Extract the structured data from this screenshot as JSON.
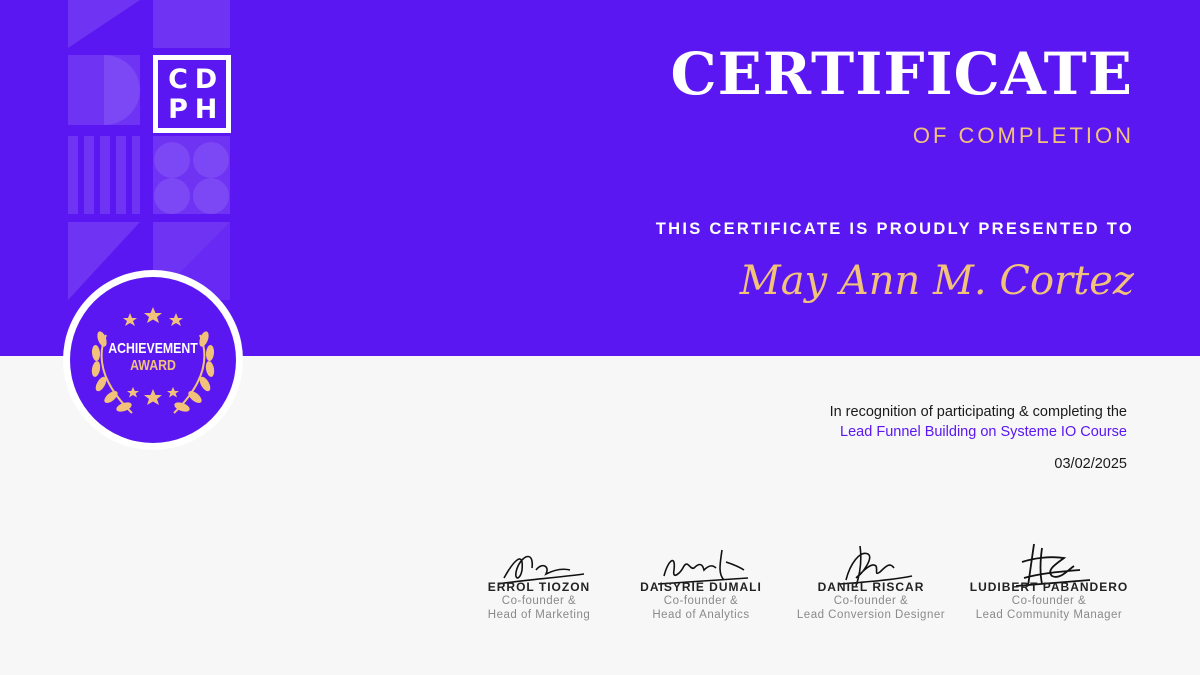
{
  "colors": {
    "primary_purple": "#5b17f2",
    "gold": "#f2c27b",
    "background": "#f7f7f8",
    "white": "#ffffff"
  },
  "logo": {
    "letters": [
      "C",
      "D",
      "P",
      "H"
    ]
  },
  "certificate": {
    "title": "CERTIFICATE",
    "subtitle": "OF COMPLETION",
    "presented_to": "THIS CERTIFICATE IS PROUDLY PRESENTED TO",
    "recipient": "May Ann M. Cortez",
    "recognition": "In recognition of participating & completing the",
    "course": "Lead Funnel Building on Systeme IO Course",
    "date": "03/02/2025"
  },
  "badge": {
    "line1": "ACHIEVEMENT",
    "line2": "AWARD",
    "icons": [
      "star-icon",
      "laurel-wreath-icon"
    ]
  },
  "signers": [
    {
      "name": "ERROL TIOZON",
      "role_line1": "Co-founder &",
      "role_line2": "Head of Marketing"
    },
    {
      "name": "DAISYRIE DUMALI",
      "role_line1": "Co-founder &",
      "role_line2": "Head of Analytics"
    },
    {
      "name": "DANIEL RISCAR",
      "role_line1": "Co-founder &",
      "role_line2": "Lead Conversion Designer"
    },
    {
      "name": "LUDIBERT PABANDERO",
      "role_line1": "Co-founder &",
      "role_line2": "Lead Community Manager"
    }
  ]
}
